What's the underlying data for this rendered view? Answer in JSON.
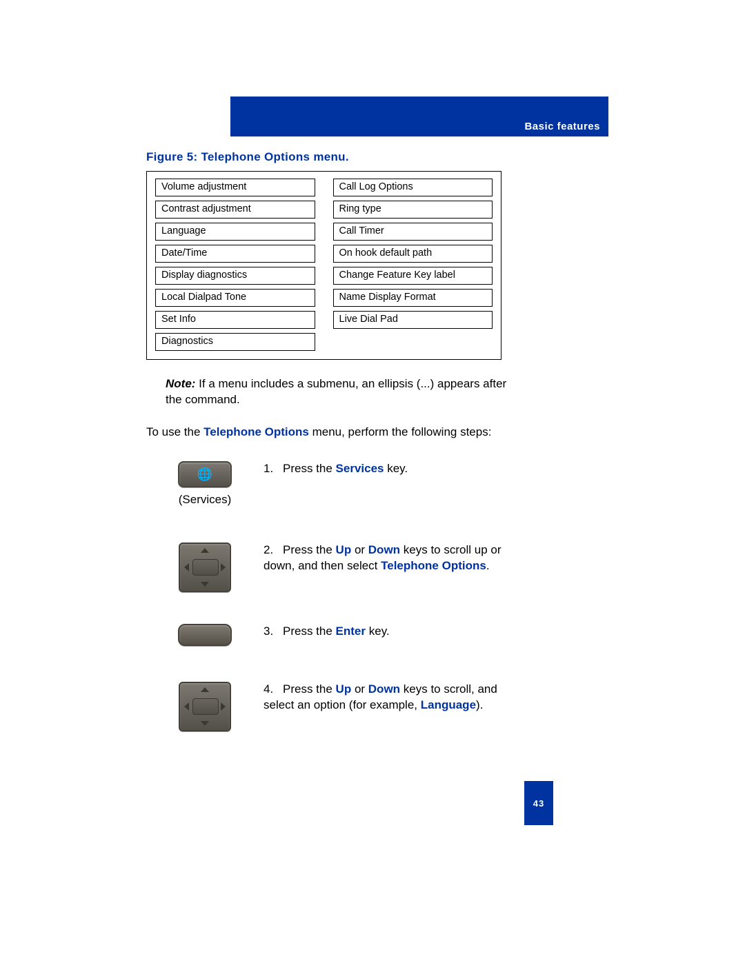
{
  "header": {
    "section_title": "Basic features"
  },
  "figure": {
    "caption": "Figure 5: Telephone Options menu."
  },
  "menu": {
    "left": [
      "Volume adjustment",
      "Contrast adjustment",
      "Language",
      "Date/Time",
      "Display diagnostics",
      "Local Dialpad Tone",
      "Set Info",
      "Diagnostics"
    ],
    "right": [
      "Call Log Options",
      "Ring type",
      "Call Timer",
      "On hook default path",
      "Change Feature Key label",
      "Name Display Format",
      "Live Dial Pad"
    ]
  },
  "note": {
    "label": "Note:",
    "text": " If a menu includes a submenu, an ellipsis (...) appears after the command."
  },
  "intro": {
    "pre": "To use the ",
    "link": "Telephone Options",
    "post": " menu, perform the following steps:"
  },
  "steps": {
    "s1": {
      "num": "1.",
      "pre": "Press the ",
      "link": "Services",
      "post": " key.",
      "icon_label": "(Services)"
    },
    "s2": {
      "num": "2.",
      "pre": "Press the ",
      "link1": "Up",
      "mid1": " or ",
      "link2": "Down",
      "mid2": " keys to scroll up or down, and then select ",
      "link3": "Telephone Options",
      "post": "."
    },
    "s3": {
      "num": "3.",
      "pre": "Press the ",
      "link": "Enter",
      "post": " key."
    },
    "s4": {
      "num": "4.",
      "pre": "Press the ",
      "link1": "Up",
      "mid1": " or ",
      "link2": "Down",
      "mid2": " keys to scroll, and select an option (for example, ",
      "link3": "Language",
      "post": ")."
    }
  },
  "page_number": "43"
}
